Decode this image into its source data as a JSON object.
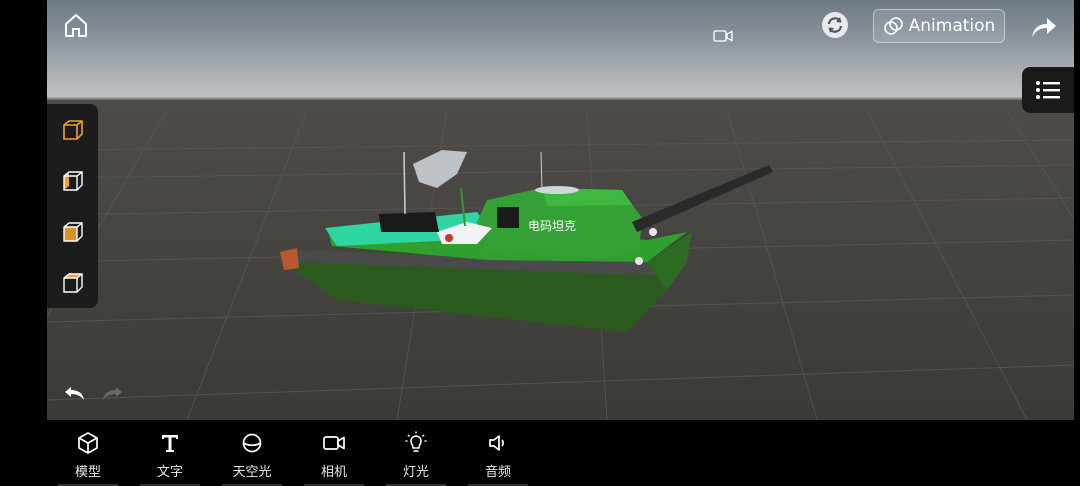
{
  "topbar": {
    "animation_label": "Animation"
  },
  "scene": {
    "tank_label": "电码坦克"
  },
  "bottom_bar": {
    "items": [
      {
        "label": "模型",
        "icon": "cube-icon"
      },
      {
        "label": "文字",
        "icon": "text-t-icon"
      },
      {
        "label": "天空光",
        "icon": "sky-sphere-icon"
      },
      {
        "label": "相机",
        "icon": "camera-icon"
      },
      {
        "label": "灯光",
        "icon": "light-bulb-icon"
      },
      {
        "label": "音频",
        "icon": "speaker-icon"
      }
    ]
  },
  "colors": {
    "accent_orange": "#f0a030",
    "tank_green": "#2e8a2e",
    "tank_teal": "#2fd6a4",
    "panel_dark": "#1c1c1c"
  }
}
